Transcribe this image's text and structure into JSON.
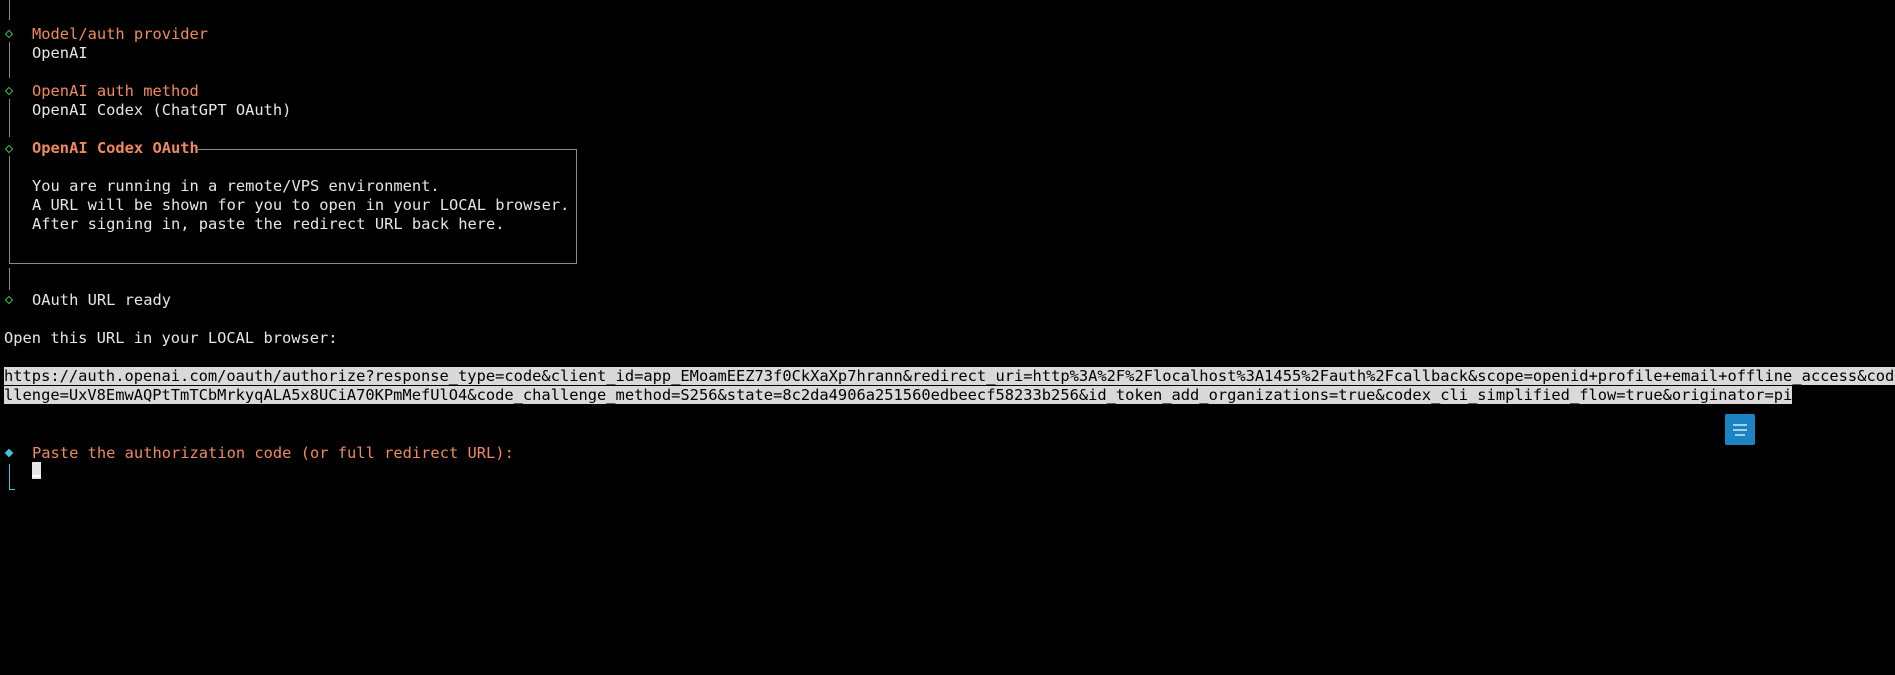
{
  "steps": {
    "model_provider": {
      "label": "Model/auth provider",
      "value": "OpenAI"
    },
    "auth_method": {
      "label": "OpenAI auth method",
      "value": "OpenAI Codex (ChatGPT OAuth)"
    },
    "codex_oauth": {
      "title": "OpenAI Codex OAuth",
      "lines": [
        "You are running in a remote/VPS environment.",
        "A URL will be shown for you to open in your LOCAL browser.",
        "After signing in, paste the redirect URL back here."
      ]
    },
    "url_ready": {
      "label": "OAuth URL ready"
    }
  },
  "open_url_prompt": "Open this URL in your LOCAL browser:",
  "auth_url": {
    "line1": "https://auth.openai.com/oauth/authorize?response_type=code&client_id=app_EMoamEEZ73f0CkXaXp7hrann&redirect_uri=http%3A%2F%2Flocalhost%3A1455%2Fauth%2Fcallback&scope=openid+profile+email+offline_access&code_cha",
    "line2": "llenge=UxV8EmwAQPtTmTCbMrkyqALA5x8UCiA70KPmMefUlO4&code_challenge_method=S256&state=8c2da4906a251560edbeecf58233b256&id_token_add_organizations=true&codex_cli_simplified_flow=true&originator=pi"
  },
  "paste_prompt": {
    "label": "Paste the authorization code (or full redirect URL):",
    "value": ""
  },
  "colors": {
    "background": "#000000",
    "label_orange": "#ef8a5e",
    "done_diamond": "#3dbf4d",
    "active_diamond": "#3fc6d8",
    "selection_bg": "#d9d9d9",
    "float_button": "#1d84c4"
  },
  "icons": {
    "done": "hollow-diamond",
    "active": "filled-diamond",
    "float_button": "menu-lines-icon"
  }
}
